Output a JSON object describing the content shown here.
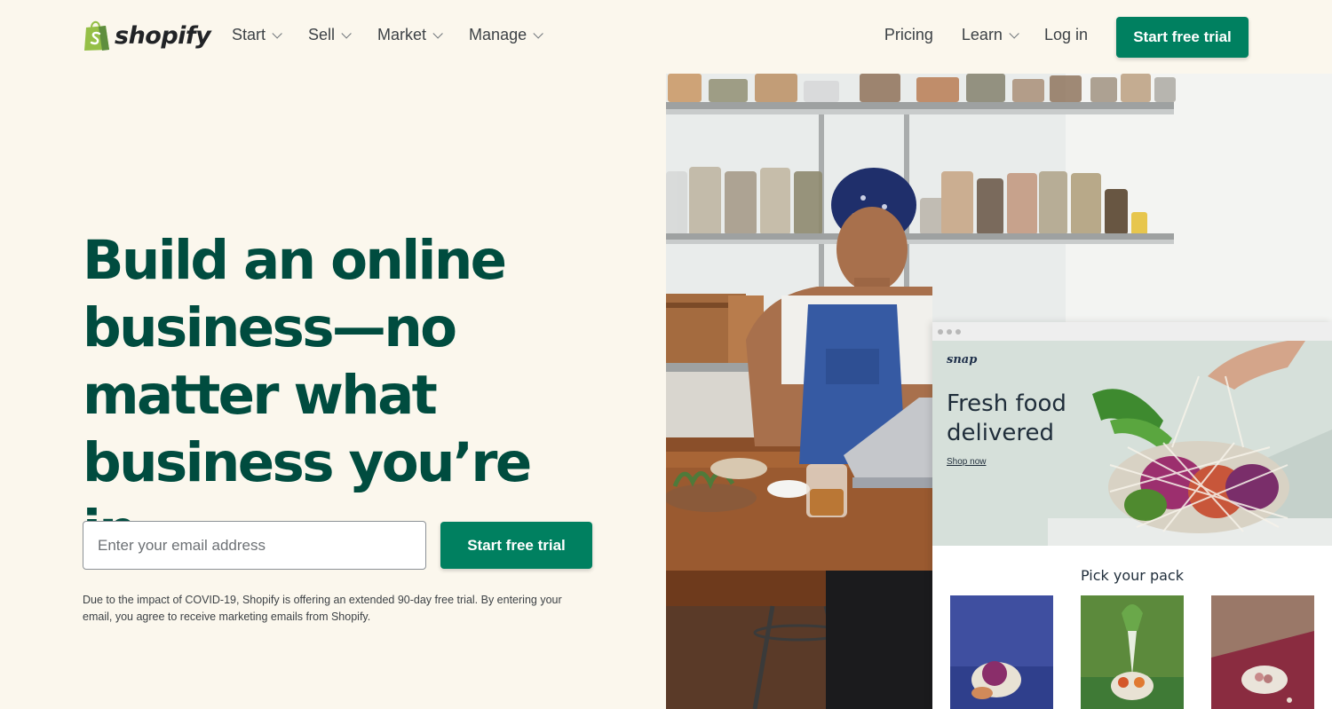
{
  "nav": {
    "logo_text": "shopify",
    "left_items": [
      {
        "label": "Start"
      },
      {
        "label": "Sell"
      },
      {
        "label": "Market"
      },
      {
        "label": "Manage"
      }
    ],
    "right_items": {
      "pricing": "Pricing",
      "learn": "Learn",
      "login": "Log in"
    },
    "cta_label": "Start free trial"
  },
  "hero": {
    "headline_lines": [
      "Build an online",
      "business—no",
      "matter what",
      "business you’re in"
    ],
    "email_placeholder": "Enter your email address",
    "cta_label": "Start free trial",
    "disclaimer": "Due to the impact of COVID-19, Shopify is offering an extended 90-day free trial. By entering your email, you agree to receive marketing emails from Shopify."
  },
  "store_mockup": {
    "brand": "snap",
    "banner_lines": [
      "Fresh food",
      "delivered"
    ],
    "shop_now": "Shop now",
    "section_title": "Pick your pack"
  },
  "colors": {
    "page_bg": "#fbf7ed",
    "brand_green": "#008060",
    "headline_green": "#004c3f",
    "logo_green": "#95bf47"
  },
  "icons": [
    "shopify-bag-icon",
    "chevron-down-icon"
  ]
}
